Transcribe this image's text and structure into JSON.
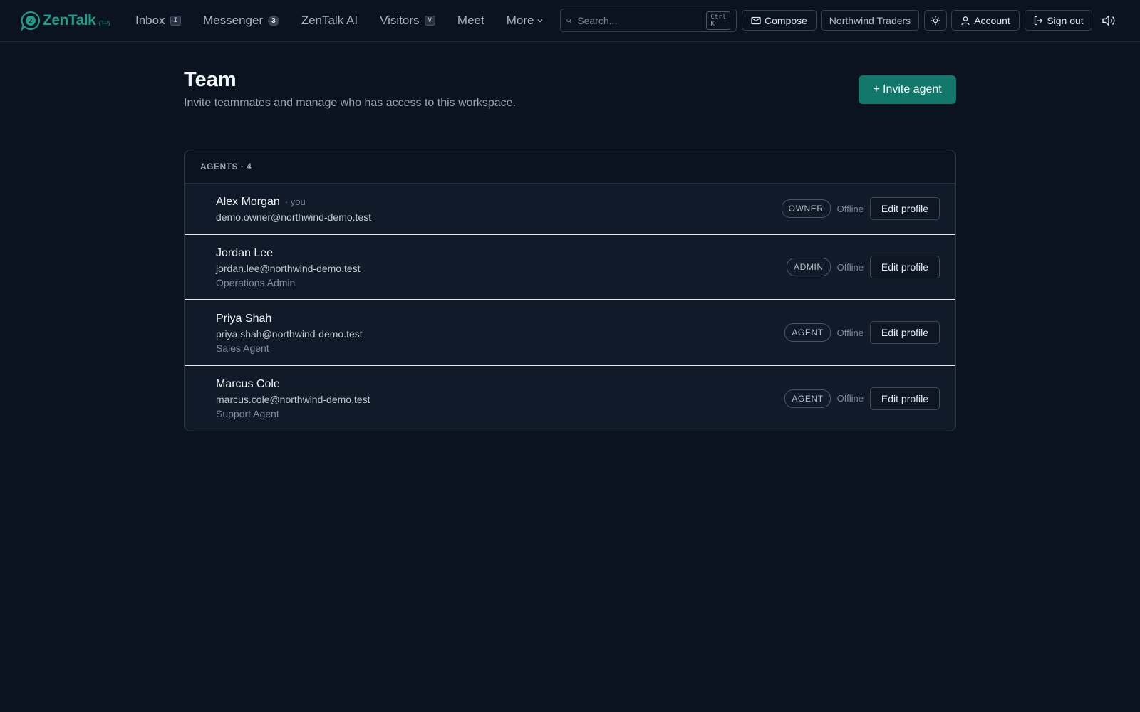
{
  "brand": {
    "name": "ZenTalk",
    "tag": "CO"
  },
  "nav": {
    "items": [
      {
        "label": "Inbox",
        "shortcut": "I"
      },
      {
        "label": "Messenger",
        "count": "3"
      },
      {
        "label": "ZenTalk AI"
      },
      {
        "label": "Visitors",
        "shortcut": "V"
      },
      {
        "label": "Meet"
      },
      {
        "label": "More"
      }
    ]
  },
  "search": {
    "placeholder": "Search...",
    "shortcut": "Ctrl K"
  },
  "toolbar": {
    "compose_label": "Compose",
    "workspace_label": "Northwind Traders",
    "account_label": "Account",
    "signout_label": "Sign out"
  },
  "page": {
    "title": "Team",
    "subtitle": "Invite teammates and manage who has access to this workspace.",
    "invite_label": "+ Invite agent"
  },
  "agents": {
    "header": "AGENTS · 4",
    "edit_label": "Edit profile",
    "list": [
      {
        "name": "Alex Morgan",
        "you": "· you",
        "email": "demo.owner@northwind-demo.test",
        "role": "",
        "badge": "OWNER",
        "status": "Offline"
      },
      {
        "name": "Jordan Lee",
        "email": "jordan.lee@northwind-demo.test",
        "role": "Operations Admin",
        "badge": "ADMIN",
        "status": "Offline"
      },
      {
        "name": "Priya Shah",
        "email": "priya.shah@northwind-demo.test",
        "role": "Sales Agent",
        "badge": "AGENT",
        "status": "Offline"
      },
      {
        "name": "Marcus Cole",
        "email": "marcus.cole@northwind-demo.test",
        "role": "Support Agent",
        "badge": "AGENT",
        "status": "Offline"
      }
    ]
  },
  "colors": {
    "accent": "#11776a",
    "background": "#0b1220",
    "brand": "#1f9e8a"
  },
  "icons": [
    "zentalk-logo-icon",
    "search-icon",
    "mail-icon",
    "sun-icon",
    "user-icon",
    "sign-out-icon",
    "speaker-icon",
    "chevron-down-icon"
  ]
}
